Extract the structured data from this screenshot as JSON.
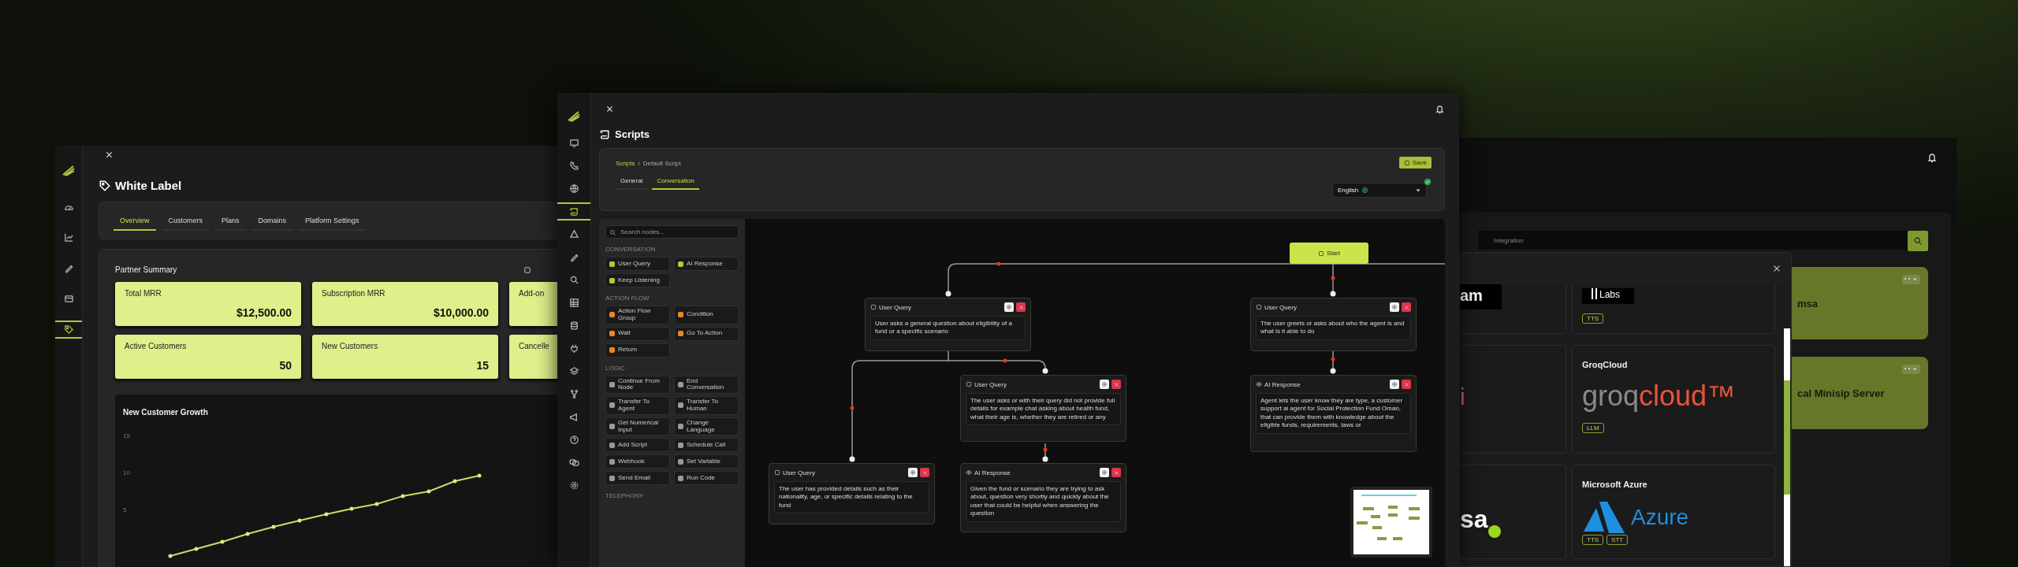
{
  "white_label_window": {
    "sidebar": [
      {
        "selected": false
      },
      {
        "selected": false
      },
      {
        "selected": false
      },
      {
        "selected": false
      },
      {
        "selected": true
      }
    ],
    "title": "White Label",
    "tabs": [
      {
        "label": "Overview",
        "selected": true
      },
      {
        "label": "Customers",
        "selected": false
      },
      {
        "label": "Plans",
        "selected": false
      },
      {
        "label": "Domains",
        "selected": false
      },
      {
        "label": "Platform Settings",
        "selected": false
      }
    ],
    "summary": {
      "title": "Partner Summary",
      "cards": [
        {
          "label": "Total MRR",
          "value": "$12,500.00"
        },
        {
          "label": "Subscription MRR",
          "value": "$10,000.00"
        },
        {
          "label": "Add-on"
        },
        {
          "label": "Active Customers",
          "value": "50"
        },
        {
          "label": "New Customers",
          "value": "15"
        },
        {
          "label": "Cancelle"
        }
      ]
    },
    "chart": {
      "title": "New Customer Growth",
      "y_tick_labels": [
        "15",
        "10",
        "5"
      ]
    }
  },
  "scripts_window": {
    "sidebar": [
      {
        "selected": false
      },
      {
        "selected": false
      },
      {
        "selected": false
      },
      {
        "selected": true
      },
      {
        "selected": false
      },
      {
        "selected": false
      },
      {
        "selected": false
      },
      {
        "selected": false
      },
      {
        "selected": false
      },
      {
        "selected": false
      },
      {
        "selected": false
      },
      {
        "selected": false
      },
      {
        "selected": false
      },
      {
        "selected": false
      },
      {
        "selected": false
      },
      {
        "selected": false
      }
    ],
    "title": "Scripts",
    "breadcrumb": {
      "link": "Scripts",
      "separator": "/",
      "current": "Default Script"
    },
    "save_button": "Save",
    "tabs": [
      {
        "label": "General",
        "selected": false
      },
      {
        "label": "Conversation",
        "selected": true
      }
    ],
    "language": {
      "value": "English"
    },
    "palette": {
      "search_placeholder": "Search nodes...",
      "sections": [
        {
          "title": "CONVERSATION",
          "items": [
            {
              "label": "User Query",
              "color": "#a8cc3c"
            },
            {
              "label": "AI Response",
              "color": "#a8cc3c"
            },
            {
              "label": "Keep Listening",
              "color": "#a8cc3c"
            }
          ]
        },
        {
          "title": "ACTION FLOW",
          "items": [
            {
              "label": "Action Flow Group",
              "color": "#e8862a"
            },
            {
              "label": "Condition",
              "color": "#e8862a"
            },
            {
              "label": "Wait",
              "color": "#e8862a"
            },
            {
              "label": "Go To Action",
              "color": "#e8862a"
            },
            {
              "label": "Return",
              "color": "#e8862a"
            }
          ]
        },
        {
          "title": "LOGIC",
          "items": [
            {
              "label": "Continue From Node",
              "color": "#9a9a9a"
            },
            {
              "label": "End Conversation",
              "color": "#9a9a9a"
            },
            {
              "label": "Transfer To Agent",
              "color": "#9a9a9a"
            },
            {
              "label": "Transfer To Human",
              "color": "#9a9a9a"
            },
            {
              "label": "Get Numerical Input",
              "color": "#9a9a9a"
            },
            {
              "label": "Change Language",
              "color": "#9a9a9a"
            },
            {
              "label": "Add Script",
              "color": "#9a9a9a"
            },
            {
              "label": "Schedule Call",
              "color": "#9a9a9a"
            },
            {
              "label": "Webhook",
              "color": "#9a9a9a"
            },
            {
              "label": "Set Variable",
              "color": "#9a9a9a"
            },
            {
              "label": "Send Email",
              "color": "#9a9a9a"
            },
            {
              "label": "Run Code",
              "color": "#9a9a9a"
            }
          ]
        },
        {
          "title": "TELEPHONY"
        }
      ]
    },
    "canvas": {
      "start_label": "Start",
      "nodes": [
        {
          "kind": "user_query",
          "title": "User Query",
          "text": "User asks a general question about eligibility of a fund or a specific scenario"
        },
        {
          "kind": "user_query",
          "title": "User Query",
          "text": "The user greets or asks about who the agent is and what is it able to do"
        },
        {
          "kind": "user_query",
          "title": "User Query",
          "text": "The user asks or with their query did not provide full details for example chat asking about health fund, what their age is, whether they are retired or any"
        },
        {
          "kind": "ai_response",
          "title": "AI Response",
          "text": "Agent lets the user know they are type, a customer support ai agent for Social Protection Fund Oman, that can provide them with knowledge about the eligible funds, requirements, laws or"
        },
        {
          "kind": "user_query",
          "title": "User Query",
          "text": "The user has provided details such as their nationality, age, or specific details relating to the fund"
        },
        {
          "kind": "ai_response",
          "title": "AI Response",
          "text": "Given the fund or scenario they are trying to ask about, question very shortly and quickly about the user that could be helpful when answering the question"
        }
      ]
    }
  },
  "integrations_window": {
    "search_placeholder": "Integration",
    "cards": [
      {
        "name": "msa"
      },
      {
        "name": "cal Minisip Server"
      }
    ],
    "dialog": {
      "providers": [
        {
          "kind": "am",
          "logo": [
            "am"
          ]
        },
        {
          "kind": "eleven",
          "logo": [
            "Labs"
          ],
          "tags": [
            "TTS"
          ]
        },
        {
          "kind": "i",
          "logo": [
            "i"
          ]
        },
        {
          "kind": "groq",
          "name": "GroqCloud",
          "logo": [
            "groq",
            "cloud™"
          ],
          "tags": [
            "LLM"
          ]
        },
        {
          "kind": "sa",
          "logo": [
            "sa"
          ]
        },
        {
          "kind": "azure",
          "name": "Microsoft Azure",
          "logo": [
            "Azure"
          ],
          "tags": [
            "TTS",
            "STT"
          ]
        }
      ]
    }
  }
}
